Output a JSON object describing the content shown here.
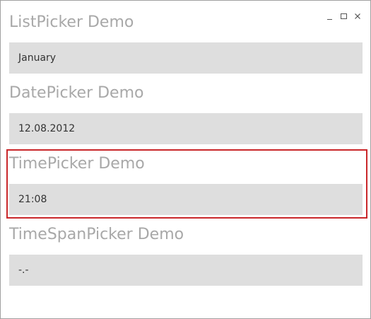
{
  "window": {
    "caption_buttons": {
      "minimize_icon": "minimize-icon",
      "maximize_icon": "maximize-icon",
      "close_icon": "close-icon"
    }
  },
  "sections": [
    {
      "title": "ListPicker Demo",
      "value": "January"
    },
    {
      "title": "DatePicker Demo",
      "value": "12.08.2012"
    },
    {
      "title": "TimePicker Demo",
      "value": "21:08"
    },
    {
      "title": "TimeSpanPicker Demo",
      "value": "-.-"
    }
  ],
  "colors": {
    "title": "#a8a8a8",
    "field_bg": "#dedede",
    "selection_border": "#c9272a"
  }
}
